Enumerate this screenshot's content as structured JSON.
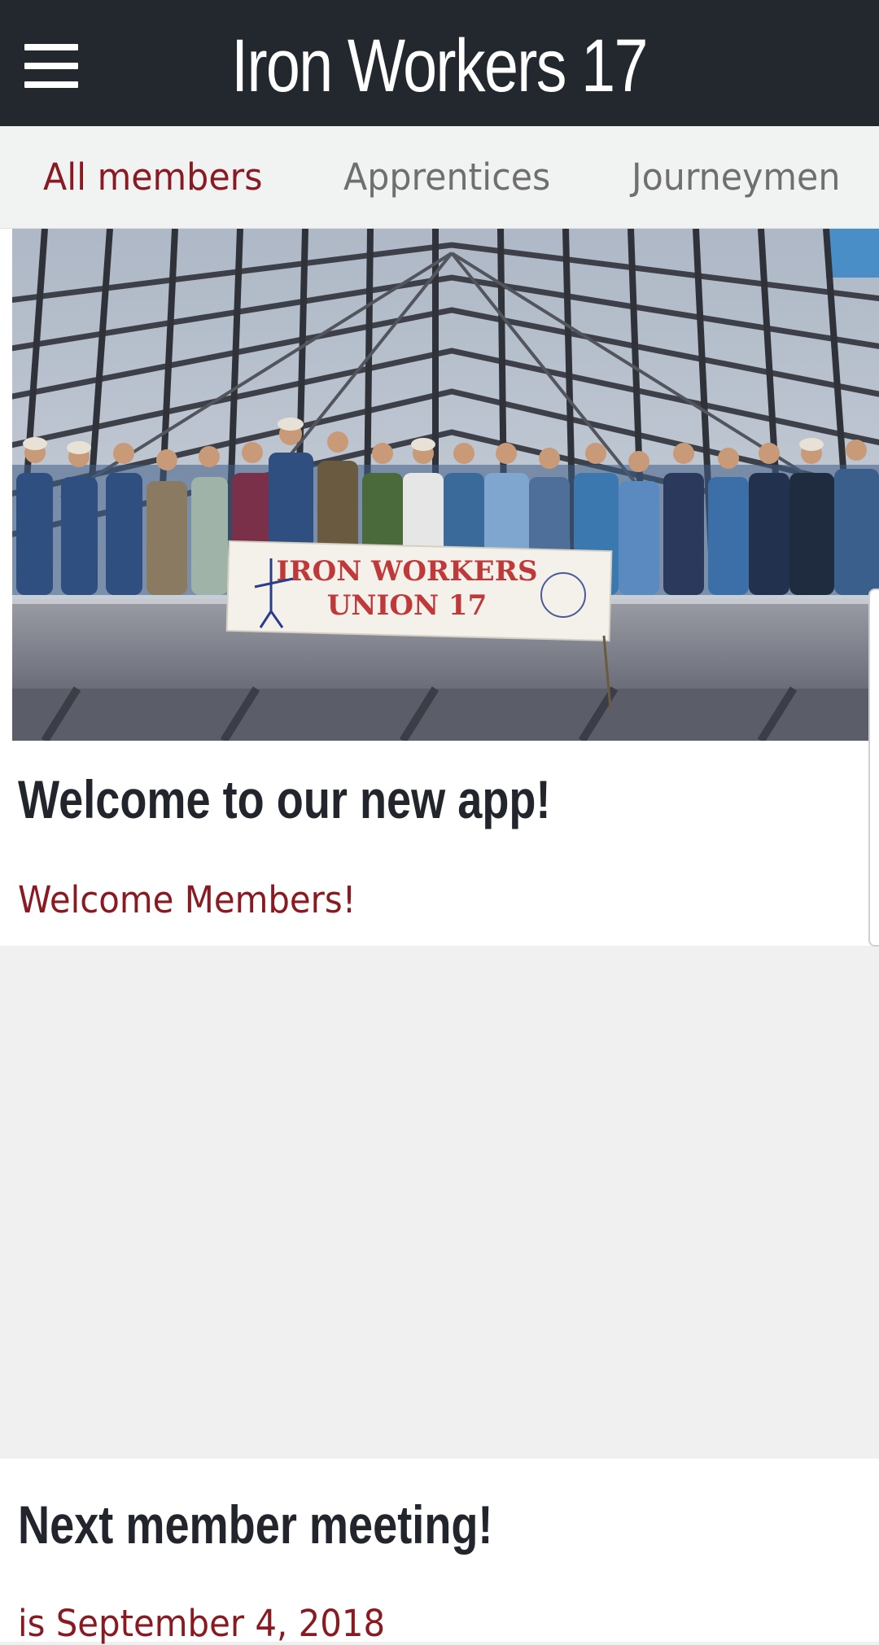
{
  "header": {
    "title": "Iron Workers 17",
    "menu_icon": "hamburger-menu-icon"
  },
  "tabs": [
    {
      "label": "All members",
      "active": true
    },
    {
      "label": "Apprentices",
      "active": false
    },
    {
      "label": "Journeymen",
      "active": false
    }
  ],
  "posts": [
    {
      "title": "Welcome to our new app!",
      "subtitle": "Welcome Members!",
      "banner_line1": "IRON WORKERS",
      "banner_line2": "UNION 17"
    },
    {
      "title": "Next member meeting!",
      "subtitle": "is September 4, 2018"
    }
  ],
  "colors": {
    "app_bar": "#23272e",
    "accent": "#8a1a22",
    "tab_inactive": "#6f6f6f",
    "background": "#f0f0f0"
  }
}
